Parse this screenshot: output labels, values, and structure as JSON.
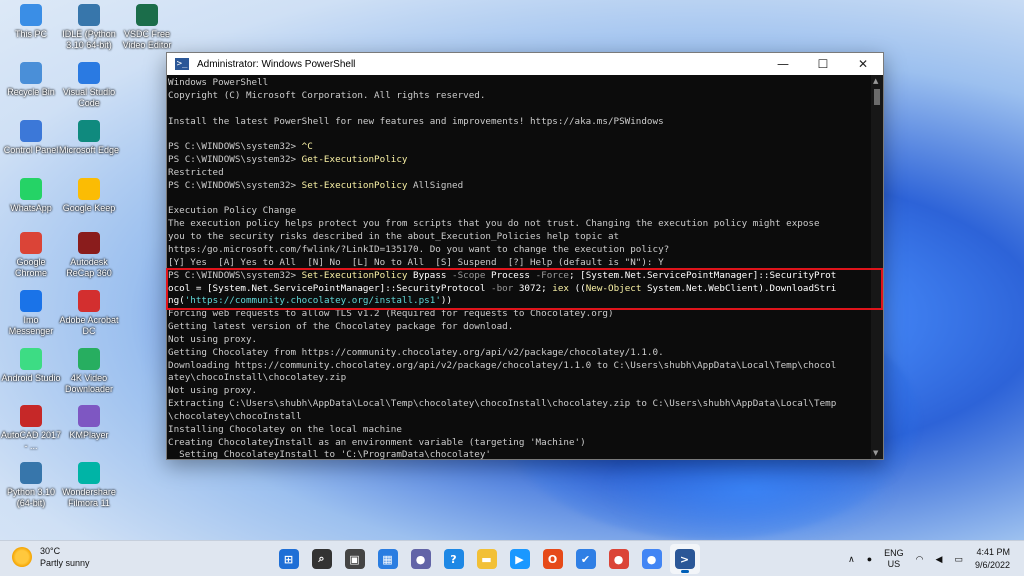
{
  "desktop": {
    "icons": [
      {
        "label": "This PC",
        "icon": "monitor-icon"
      },
      {
        "label": "IDLE (Python 3.10 64-bit)",
        "icon": "python-idle-icon"
      },
      {
        "label": "VSDC Free Video Editor",
        "icon": "vsdc-icon"
      },
      {
        "label": "Recycle Bin",
        "icon": "recycle-bin-icon"
      },
      {
        "label": "Visual Studio Code",
        "icon": "vscode-icon"
      },
      {
        "label": "Control Panel",
        "icon": "control-panel-icon"
      },
      {
        "label": "Microsoft Edge",
        "icon": "edge-icon"
      },
      {
        "label": "WhatsApp",
        "icon": "whatsapp-icon"
      },
      {
        "label": "Google Keep",
        "icon": "google-keep-icon"
      },
      {
        "label": "Google Chrome",
        "icon": "chrome-icon"
      },
      {
        "label": "Autodesk ReCap 360",
        "icon": "recap-icon"
      },
      {
        "label": "Imo Messenger",
        "icon": "imo-icon"
      },
      {
        "label": "Adobe Acrobat DC",
        "icon": "acrobat-icon"
      },
      {
        "label": "Android Studio",
        "icon": "android-studio-icon"
      },
      {
        "label": "4K Video Downloader",
        "icon": "4k-video-icon"
      },
      {
        "label": "AutoCAD 2017 - ...",
        "icon": "autocad-icon"
      },
      {
        "label": "KMPlayer",
        "icon": "kmplayer-icon"
      },
      {
        "label": "Python 3.10 (64-bit)",
        "icon": "python-icon"
      },
      {
        "label": "Wondershare Filmora 11",
        "icon": "filmora-icon"
      }
    ]
  },
  "window": {
    "title": "Administrator: Windows PowerShell",
    "app_icon_glyph": ">_",
    "controls": {
      "minimize": "—",
      "maximize": "☐",
      "close": "✕"
    }
  },
  "console_lines": [
    [
      {
        "t": "Windows PowerShell"
      }
    ],
    [
      {
        "t": "Copyright (C) Microsoft Corporation. All rights reserved."
      }
    ],
    [
      {
        "t": ""
      }
    ],
    [
      {
        "t": "Install the latest PowerShell for new features and improvements! https://aka.ms/PSWindows"
      }
    ],
    [
      {
        "t": ""
      }
    ],
    [
      {
        "t": "PS C:\\WINDOWS\\system32> "
      },
      {
        "t": "^C",
        "c": "y"
      }
    ],
    [
      {
        "t": "PS C:\\WINDOWS\\system32> "
      },
      {
        "t": "Get-ExecutionPolicy",
        "c": "y"
      }
    ],
    [
      {
        "t": "Restricted"
      }
    ],
    [
      {
        "t": "PS C:\\WINDOWS\\system32> "
      },
      {
        "t": "Set-ExecutionPolicy",
        "c": "y"
      },
      {
        "t": " AllSigned"
      }
    ],
    [
      {
        "t": ""
      }
    ],
    [
      {
        "t": "Execution Policy Change"
      }
    ],
    [
      {
        "t": "The execution policy helps protect you from scripts that you do not trust. Changing the execution policy might expose"
      }
    ],
    [
      {
        "t": "you to the security risks described in the about_Execution_Policies help topic at"
      }
    ],
    [
      {
        "t": "https:/go.microsoft.com/fwlink/?LinkID=135170. Do you want to change the execution policy?"
      }
    ],
    [
      {
        "t": "[Y] Yes  [A] Yes to All  [N] No  [L] No to All  [S] Suspend  [?] Help (default is \"N\"): Y"
      }
    ],
    [
      {
        "t": "PS C:\\WINDOWS\\system32> "
      },
      {
        "t": "Set-ExecutionPolicy",
        "c": "y"
      },
      {
        "t": " Bypass ",
        "c": "w"
      },
      {
        "t": "-Scope",
        "c": "g"
      },
      {
        "t": " Process ",
        "c": "w"
      },
      {
        "t": "-Force",
        "c": "g"
      },
      {
        "t": "; [System.Net.ServicePointManager]::SecurityProt",
        "c": "w"
      }
    ],
    [
      {
        "t": "ocol = [System.Net.ServicePointManager]::SecurityProtocol ",
        "c": "w"
      },
      {
        "t": "-bor",
        "c": "g"
      },
      {
        "t": " 3072; ",
        "c": "w"
      },
      {
        "t": "iex",
        "c": "y"
      },
      {
        "t": " ((",
        "c": "w"
      },
      {
        "t": "New-Object",
        "c": "y"
      },
      {
        "t": " System.Net.WebClient).DownloadStri",
        "c": "w"
      }
    ],
    [
      {
        "t": "ng(",
        "c": "w"
      },
      {
        "t": "'https://community.chocolatey.org/install.ps1'",
        "c": "c"
      },
      {
        "t": "))",
        "c": "w"
      }
    ],
    [
      {
        "t": "Forcing web requests to allow TLS v1.2 (Required for requests to Chocolatey.org)"
      }
    ],
    [
      {
        "t": "Getting latest version of the Chocolatey package for download."
      }
    ],
    [
      {
        "t": "Not using proxy."
      }
    ],
    [
      {
        "t": "Getting Chocolatey from https://community.chocolatey.org/api/v2/package/chocolatey/1.1.0."
      }
    ],
    [
      {
        "t": "Downloading https://community.chocolatey.org/api/v2/package/chocolatey/1.1.0 to C:\\Users\\shubh\\AppData\\Local\\Temp\\chocol"
      }
    ],
    [
      {
        "t": "atey\\chocoInstall\\chocolatey.zip"
      }
    ],
    [
      {
        "t": "Not using proxy."
      }
    ],
    [
      {
        "t": "Extracting C:\\Users\\shubh\\AppData\\Local\\Temp\\chocolatey\\chocoInstall\\chocolatey.zip to C:\\Users\\shubh\\AppData\\Local\\Temp"
      }
    ],
    [
      {
        "t": "\\chocolatey\\chocoInstall"
      }
    ],
    [
      {
        "t": "Installing Chocolatey on the local machine"
      }
    ],
    [
      {
        "t": "Creating ChocolateyInstall as an environment variable (targeting 'Machine')"
      }
    ],
    [
      {
        "t": "  Setting ChocolateyInstall to 'C:\\ProgramData\\chocolatey'"
      }
    ]
  ],
  "taskbar": {
    "weather": {
      "temp": "30°C",
      "condition": "Partly sunny"
    },
    "apps": [
      {
        "name": "start-button",
        "glyph": "⊞",
        "color": "#1f6fd6"
      },
      {
        "name": "search-button",
        "glyph": "⌕",
        "color": "#333333"
      },
      {
        "name": "task-view-button",
        "glyph": "▣",
        "color": "#444444"
      },
      {
        "name": "widgets-button",
        "glyph": "▦",
        "color": "#2a7de1"
      },
      {
        "name": "teams-chat-button",
        "glyph": "●",
        "color": "#6264a7"
      },
      {
        "name": "help-button",
        "glyph": "?",
        "color": "#1e88e5"
      },
      {
        "name": "file-explorer-button",
        "glyph": "▬",
        "color": "#f2c037"
      },
      {
        "name": "prime-video-button",
        "glyph": "▶",
        "color": "#1a98ff"
      },
      {
        "name": "office-button",
        "glyph": "O",
        "color": "#e64a19"
      },
      {
        "name": "todo-button",
        "glyph": "✔",
        "color": "#2f7fe5"
      },
      {
        "name": "chrome-button",
        "glyph": "●",
        "color": "#db4437"
      },
      {
        "name": "chrome-profile-button",
        "glyph": "●",
        "color": "#4285f4"
      },
      {
        "name": "powershell-button",
        "glyph": ">",
        "color": "#2b5797"
      }
    ],
    "tray": {
      "chevron": "∧",
      "mic": "●",
      "lang_top": "ENG",
      "lang_bottom": "US",
      "wifi": "◠",
      "volume": "◀",
      "battery": "▭",
      "time": "4:41 PM",
      "date": "9/6/2022"
    }
  }
}
